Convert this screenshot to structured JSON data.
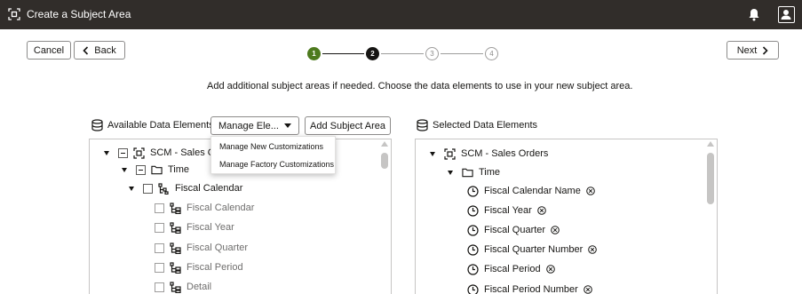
{
  "window": {
    "title": "Create a Subject Area",
    "app_icon": "subject-area-icon",
    "notification_icon": "bell-icon",
    "user_icon": "user-profile-icon"
  },
  "nav": {
    "cancel_label": "Cancel",
    "back_label": "Back",
    "back_icon": "chevron-left-icon",
    "next_label": "Next",
    "next_icon": "chevron-right-icon"
  },
  "steps": [
    {
      "label": "1",
      "state": "done"
    },
    {
      "label": "2",
      "state": "active"
    },
    {
      "label": "3",
      "state": "todo"
    },
    {
      "label": "4",
      "state": "todo"
    }
  ],
  "instruction": "Add additional subject areas if needed. Choose the data elements to use in your new subject area.",
  "available": {
    "title": "Available Data Elements",
    "icon": "database-icon",
    "manage_label": "Manage Ele...",
    "add_label": "Add Subject Area",
    "menu": [
      "Manage New Customizations",
      "Manage Factory Customizations"
    ],
    "tree": [
      {
        "label": "SCM - Sales O",
        "icon": "subject-area-icon"
      },
      {
        "label": "Time",
        "icon": "folder-icon"
      },
      {
        "label": "Fiscal Calendar",
        "icon": "hierarchy-icon"
      },
      {
        "label": "Fiscal Calendar",
        "icon": "level-icon"
      },
      {
        "label": "Fiscal Year",
        "icon": "level-icon"
      },
      {
        "label": "Fiscal Quarter",
        "icon": "level-icon"
      },
      {
        "label": "Fiscal Period",
        "icon": "level-icon"
      },
      {
        "label": "Detail",
        "icon": "level-icon"
      }
    ]
  },
  "selected": {
    "title": "Selected Data Elements",
    "icon": "database-icon",
    "tree": [
      {
        "label": "SCM - Sales Orders",
        "icon": "subject-area-icon"
      },
      {
        "label": "Time",
        "icon": "folder-icon"
      },
      {
        "label": "Fiscal Calendar Name",
        "icon": "clock-icon"
      },
      {
        "label": "Fiscal Year",
        "icon": "clock-icon"
      },
      {
        "label": "Fiscal Quarter",
        "icon": "clock-icon"
      },
      {
        "label": "Fiscal Quarter Number",
        "icon": "clock-icon"
      },
      {
        "label": "Fiscal Period",
        "icon": "clock-icon"
      },
      {
        "label": "Fiscal Period Number",
        "icon": "clock-icon"
      }
    ]
  },
  "colors": {
    "topbar": "#312d2a",
    "step_done": "#4d7a1e",
    "step_active": "#161513",
    "border": "#8c8b8a"
  }
}
